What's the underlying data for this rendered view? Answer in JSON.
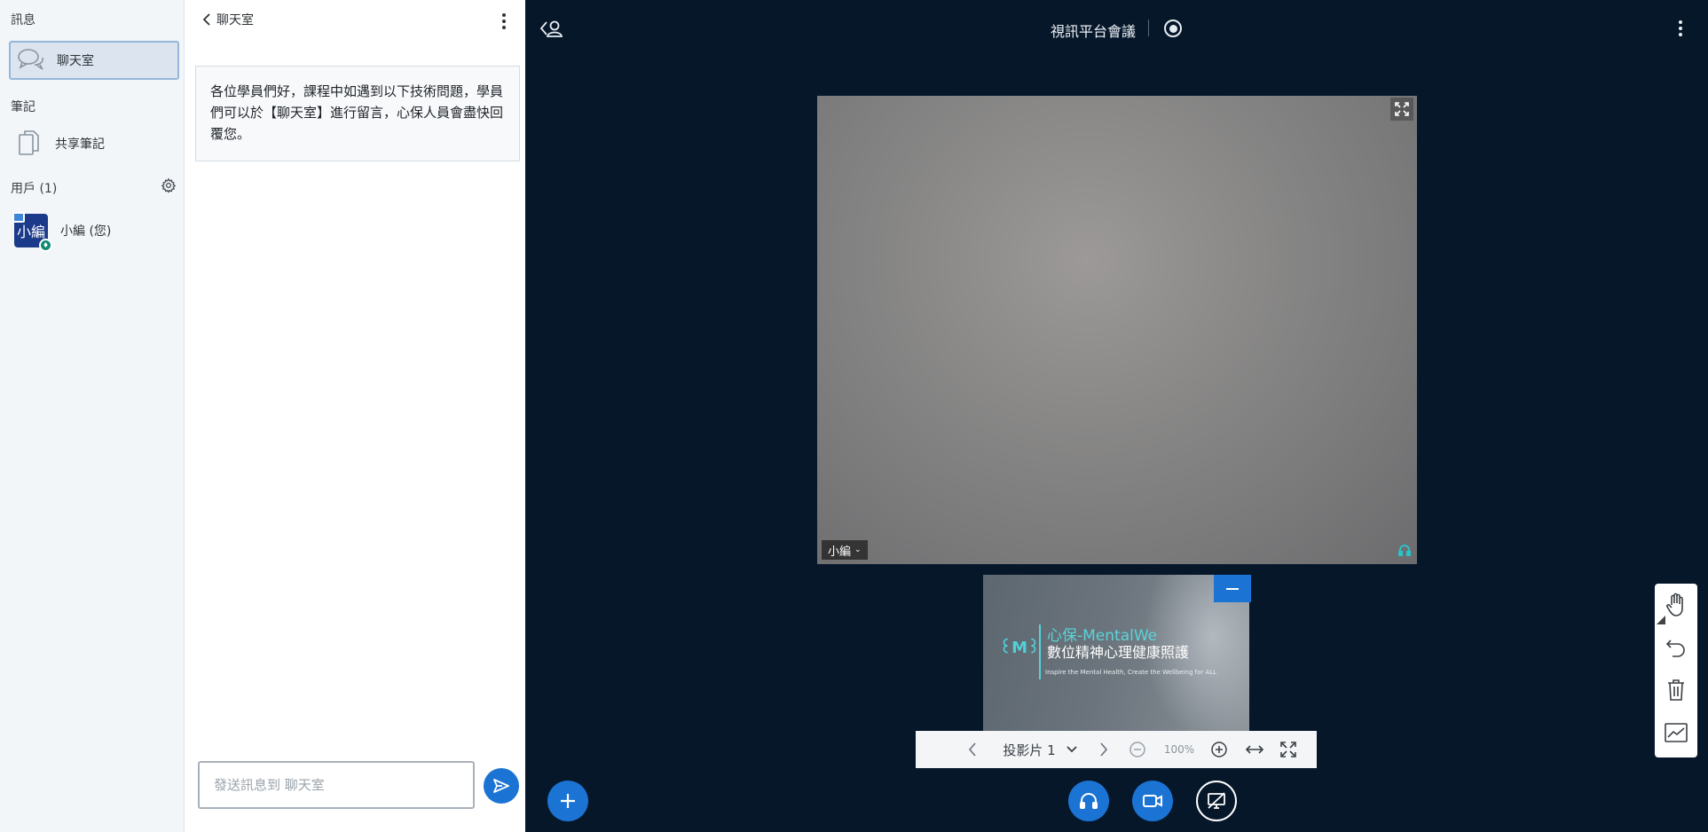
{
  "userlist": {
    "messages_title": "訊息",
    "chat_item_label": "聊天室",
    "notes_title": "筆記",
    "shared_notes_label": "共享筆記",
    "users_title": "用戶 (1)",
    "user": {
      "avatar_text": "小編",
      "name": "小編 (您)"
    }
  },
  "chat": {
    "header_title": "聊天室",
    "welcome_message": "各位學員們好，課程中如遇到以下技術問題，學員們可以於【聊天室】進行留言，心保人員會盡快回覆您。",
    "input_placeholder": "發送訊息到 聊天室"
  },
  "main": {
    "meeting_title": "視訊平台會議",
    "webcam_user": "小編",
    "slide": {
      "brand": "心保-MentalWe",
      "tagline": "數位精神心理健康照護",
      "small_text": "Inspire the Mental Health, Create the Wellbeing for ALL"
    },
    "toolbar": {
      "slide_label": "投影片 1",
      "zoom_label": "100%"
    }
  },
  "colors": {
    "accent": "#1b74d4",
    "stage_bg": "#06172a",
    "sidebar_bg": "#f3f6f9"
  }
}
